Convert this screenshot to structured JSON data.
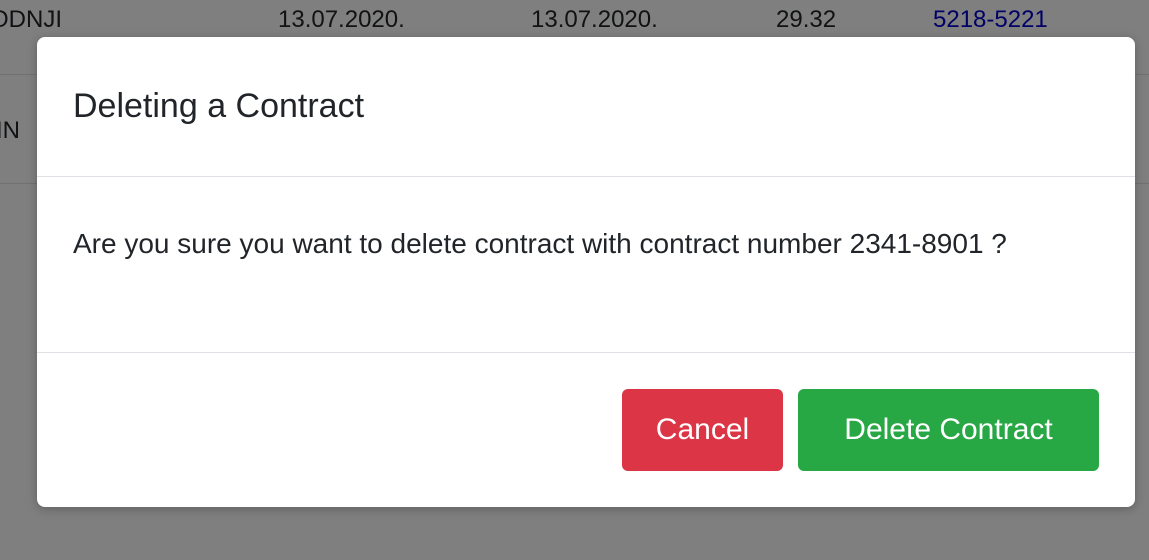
{
  "background_table": {
    "row1": {
      "name_fragment": "ODNJI",
      "date_start": "13.07.2020.",
      "date_end": "13.07.2020.",
      "amount": "29.32",
      "contract_number": "5218-5221"
    },
    "row2": {
      "name_fragment": "IN"
    }
  },
  "modal": {
    "title": "Deleting a Contract",
    "message": "Are you sure you want to delete contract with contract number 2341-8901 ?",
    "cancel_label": "Cancel",
    "confirm_label": "Delete Contract"
  },
  "colors": {
    "cancel": "#dc3545",
    "confirm": "#28a745",
    "link": "#0000cc"
  }
}
